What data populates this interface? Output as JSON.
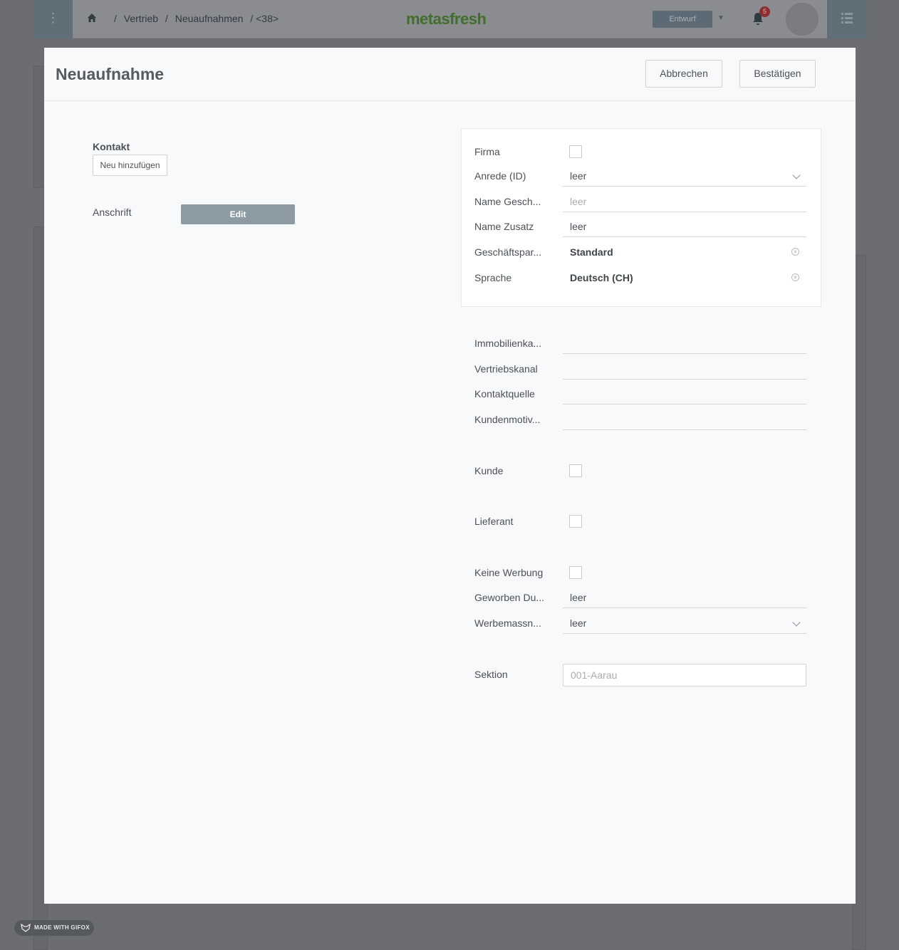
{
  "header": {
    "breadcrumbs": [
      "/",
      "Vertrieb",
      "/",
      "Neuaufnahmen",
      "/ <38>"
    ],
    "logo": "metasfresh",
    "status": "Entwurf",
    "notification_count": "5"
  },
  "modal": {
    "title": "Neuaufnahme",
    "cancel_label": "Abbrechen",
    "confirm_label": "Bestätigen"
  },
  "left": {
    "contact_label": "Kontakt",
    "add_new_label": "Neu hinzufügen",
    "address_label": "Anschrift",
    "edit_label": "Edit"
  },
  "fields": {
    "firma": {
      "label": "Firma"
    },
    "anrede": {
      "label": "Anrede (ID)",
      "value": "leer"
    },
    "name_gesch": {
      "label": "Name Gesch...",
      "placeholder": "leer"
    },
    "name_zusatz": {
      "label": "Name Zusatz",
      "value": "leer"
    },
    "geschaeftspartner": {
      "label": "Geschäftspar...",
      "value": "Standard"
    },
    "sprache": {
      "label": "Sprache",
      "value": "Deutsch (CH)"
    },
    "immobilien": {
      "label": "Immobilienka...",
      "value": ""
    },
    "vertriebskanal": {
      "label": "Vertriebskanal",
      "value": ""
    },
    "kontaktquelle": {
      "label": "Kontaktquelle",
      "value": ""
    },
    "kundenmotiv": {
      "label": "Kundenmotiv...",
      "value": ""
    },
    "kunde": {
      "label": "Kunde"
    },
    "lieferant": {
      "label": "Lieferant"
    },
    "keine_werbung": {
      "label": "Keine Werbung"
    },
    "geworben": {
      "label": "Geworben Du...",
      "value": "leer"
    },
    "werbemassn": {
      "label": "Werbemassn...",
      "value": "leer"
    },
    "sektion": {
      "label": "Sektion",
      "value": "001-Aarau"
    }
  },
  "watermark": "MADE WITH GIFOX"
}
